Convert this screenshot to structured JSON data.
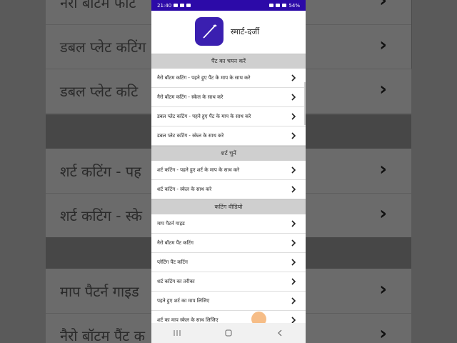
{
  "status_bar": {
    "time": "21:40",
    "battery": "54%"
  },
  "app": {
    "title": "स्मार्ट-दर्जी",
    "logo_icon": "needle-icon"
  },
  "sections": [
    {
      "header": "पैंट का चयन करें",
      "items": [
        "नैरो बॉटम कटिंग - पहने हुए पैंट के माप के साथ करे",
        "नैरो बॉटम कटिंग - स्केल के साथ करे",
        "डबल प्लेट कटिंग - पहने हुए पैंट के माप के साथ करे",
        "डबल प्लेट कटिंग - स्केल के साथ करे"
      ]
    },
    {
      "header": "शर्ट चुनें",
      "items": [
        "शर्ट कटिंग - पहने हुए शर्ट के माप के साथ करे",
        "शर्ट कटिंग - स्केल के साथ करे"
      ]
    },
    {
      "header": "कटिंग वीडियो",
      "items": [
        "माप पैटर्न गाइड",
        "नैरो बॉटम पैंट कटिंग",
        "प्लेटिंग पैंट कटिंग",
        "शर्ट कटिंग का तरीका",
        "पहने हुए शर्ट का माप लिजिए",
        "शर्ट का माप स्केल के साथ लिजिए"
      ]
    }
  ],
  "background": {
    "rows": [
      {
        "text": "नैरो बॉटम फटि"
      },
      {
        "text": "डबल प्लेट कटिंग"
      },
      {
        "text": "डबल प्लेट कटि"
      },
      {
        "text": "शर्ट कटिंग - पह"
      },
      {
        "text": "शर्ट कटिंग - स्के"
      },
      {
        "text": "माप पैटर्न गाइड"
      },
      {
        "text": "नैरो बॉटम पैंट क"
      }
    ]
  },
  "colors": {
    "status_bar": "#2c0aa8",
    "section_bg": "#cfcfcf",
    "logo": "#3a1fb0"
  }
}
